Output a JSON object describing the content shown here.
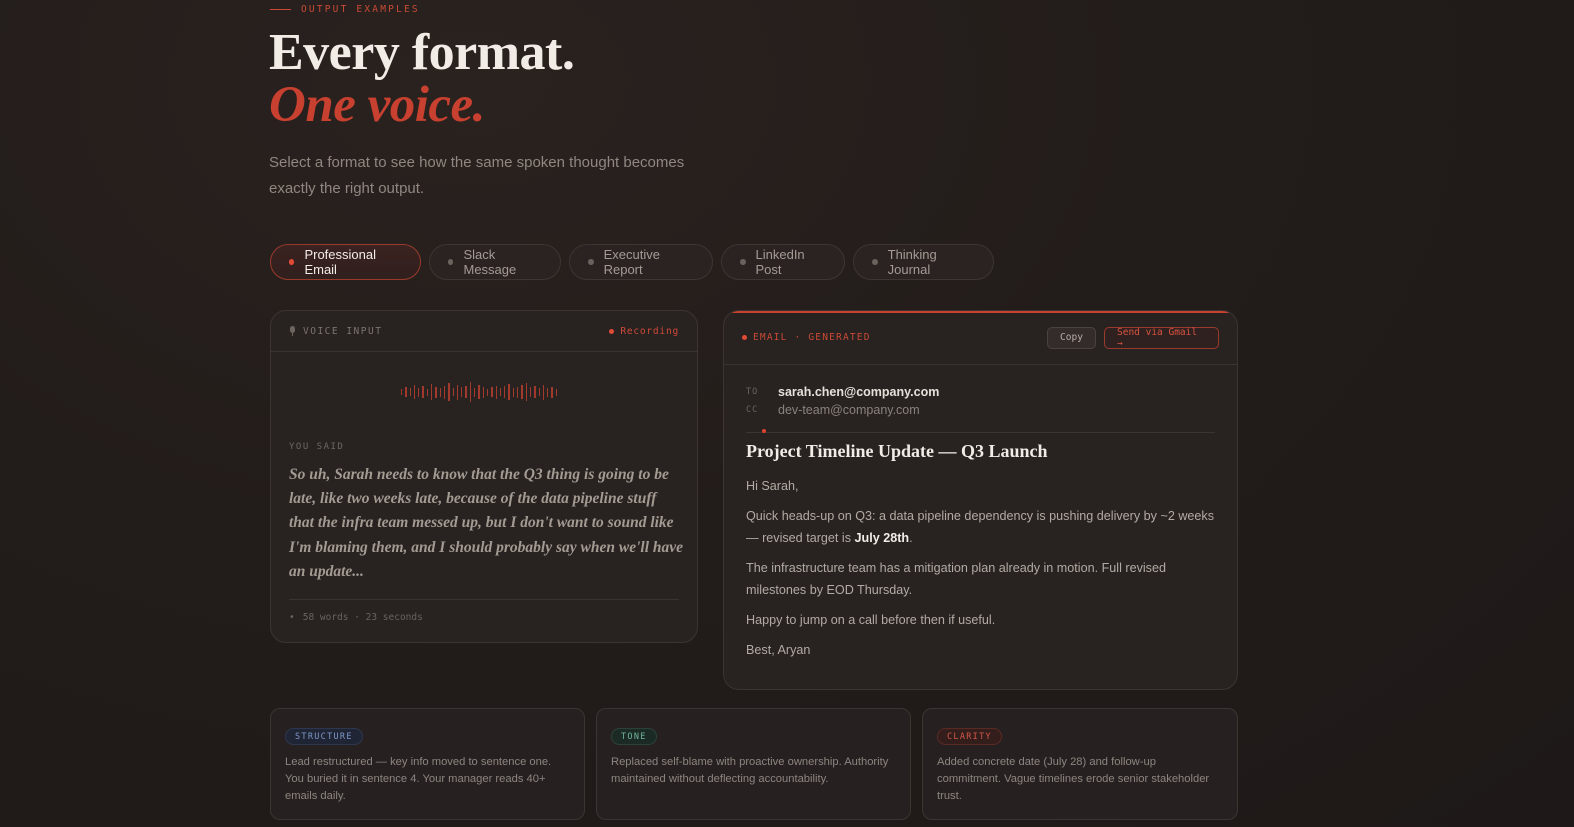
{
  "header": {
    "eyebrow": "OUTPUT EXAMPLES",
    "title_line1": "Every format.",
    "title_line2": "One voice.",
    "subtitle": "Select a format to see how the same spoken thought becomes exactly the right output."
  },
  "tabs": [
    {
      "label": "Professional Email",
      "active": true
    },
    {
      "label": "Slack Message",
      "active": false
    },
    {
      "label": "Executive Report",
      "active": false
    },
    {
      "label": "LinkedIn Post",
      "active": false
    },
    {
      "label": "Thinking Journal",
      "active": false
    }
  ],
  "voice": {
    "label": "VOICE INPUT",
    "status": "Recording",
    "you_said_label": "YOU SAID",
    "quote": "So uh, Sarah needs to know that the Q3 thing is going to be late, like two weeks late, because of the data pipeline stuff that the infra team messed up, but I don't want to sound like I'm blaming them, and I should probably say when we'll have an update...",
    "meta": "58 words · 23 seconds"
  },
  "email": {
    "label": "EMAIL · GENERATED",
    "copy_label": "Copy",
    "send_label": "Send via Gmail →",
    "to_label": "TO",
    "to": "sarah.chen@company.com",
    "cc_label": "CC",
    "cc": "dev-team@company.com",
    "subject": "Project Timeline Update — Q3 Launch",
    "greeting": "Hi Sarah,",
    "p1_before": "Quick heads-up on Q3: a data pipeline dependency is pushing delivery by ~2 weeks — revised target is ",
    "p1_bold": "July 28th",
    "p1_after": ".",
    "p2": "The infrastructure team has a mitigation plan already in motion. Full revised milestones by EOD Thursday.",
    "p3": "Happy to jump on a call before then if useful.",
    "signoff": "Best, Aryan"
  },
  "notes": [
    {
      "tag": "STRUCTURE",
      "text": "Lead restructured — key info moved to sentence one. You buried it in sentence 4. Your manager reads 40+ emails daily."
    },
    {
      "tag": "TONE",
      "text": "Replaced self-blame with proactive ownership. Authority maintained without deflecting accountability."
    },
    {
      "tag": "CLARITY",
      "text": "Added concrete date (July 28) and follow-up commitment. Vague timelines erode senior stakeholder trust."
    }
  ]
}
